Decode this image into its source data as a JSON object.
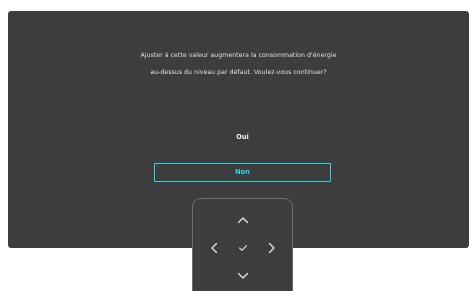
{
  "dialog": {
    "message_line1": "Ajuster à cette valeur augmentera la consommation d'énergie",
    "message_line2": "au-dessus du niveau par défaut. Voulez-vous continuer?",
    "yes_label": "Oui",
    "no_label": "Non",
    "selected_option": "Non"
  },
  "nav": {
    "up_icon": "chevron-up-icon",
    "left_icon": "chevron-left-icon",
    "ok_icon": "checkmark-icon",
    "right_icon": "chevron-right-icon",
    "down_icon": "chevron-down-icon"
  },
  "colors": {
    "panel_bg": "#3d3d3d",
    "text": "#e4e4e4",
    "accent": "#2bd6e0"
  }
}
